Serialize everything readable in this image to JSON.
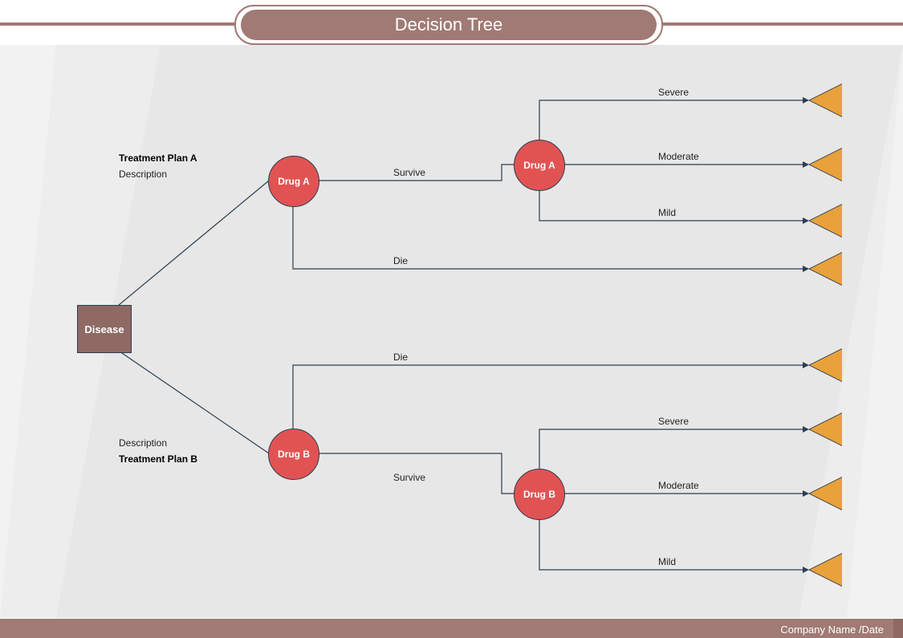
{
  "title": "Decision Tree",
  "footer": "Company Name /Date",
  "root": {
    "label": "Disease"
  },
  "nodes": {
    "drugA1": "Drug A",
    "drugA2": "Drug A",
    "drugB1": "Drug  B",
    "drugB2": "Drug  B"
  },
  "labels": {
    "planA": "Treatment Plan A",
    "planB": "Treatment Plan B",
    "descA": "Description",
    "descB": "Description",
    "surviveA": "Survive",
    "surviveB": "Survive",
    "dieA": "Die",
    "dieB": "Die",
    "severeA": "Severe",
    "moderateA": "Moderate",
    "mildA": "Mild",
    "severeB": "Severe",
    "moderateB": "Moderate",
    "mildB": "Mild"
  },
  "chart_data": {
    "type": "decision-tree",
    "title": "Decision Tree",
    "root": {
      "id": "disease",
      "kind": "decision",
      "label": "Disease"
    },
    "edges": [
      {
        "from": "disease",
        "to": "drugA1",
        "label": "Treatment Plan A",
        "sublabel": "Description"
      },
      {
        "from": "disease",
        "to": "drugB1",
        "label": "Treatment Plan B",
        "sublabel": "Description"
      },
      {
        "from": "drugA1",
        "to": "drugA2",
        "label": "Survive"
      },
      {
        "from": "drugA1",
        "to": "termA_die",
        "label": "Die"
      },
      {
        "from": "drugA2",
        "to": "termA_sev",
        "label": "Severe"
      },
      {
        "from": "drugA2",
        "to": "termA_mod",
        "label": "Moderate"
      },
      {
        "from": "drugA2",
        "to": "termA_mild",
        "label": "Mild"
      },
      {
        "from": "drugB1",
        "to": "termB_die",
        "label": "Die"
      },
      {
        "from": "drugB1",
        "to": "drugB2",
        "label": "Survive"
      },
      {
        "from": "drugB2",
        "to": "termB_sev",
        "label": "Severe"
      },
      {
        "from": "drugB2",
        "to": "termB_mod",
        "label": "Moderate"
      },
      {
        "from": "drugB2",
        "to": "termB_mild",
        "label": "Mild"
      }
    ],
    "nodes": [
      {
        "id": "drugA1",
        "kind": "chance",
        "label": "Drug A"
      },
      {
        "id": "drugA2",
        "kind": "chance",
        "label": "Drug A"
      },
      {
        "id": "drugB1",
        "kind": "chance",
        "label": "Drug B"
      },
      {
        "id": "drugB2",
        "kind": "chance",
        "label": "Drug B"
      },
      {
        "id": "termA_die",
        "kind": "terminal"
      },
      {
        "id": "termA_sev",
        "kind": "terminal"
      },
      {
        "id": "termA_mod",
        "kind": "terminal"
      },
      {
        "id": "termA_mild",
        "kind": "terminal"
      },
      {
        "id": "termB_die",
        "kind": "terminal"
      },
      {
        "id": "termB_sev",
        "kind": "terminal"
      },
      {
        "id": "termB_mod",
        "kind": "terminal"
      },
      {
        "id": "termB_mild",
        "kind": "terminal"
      }
    ]
  }
}
